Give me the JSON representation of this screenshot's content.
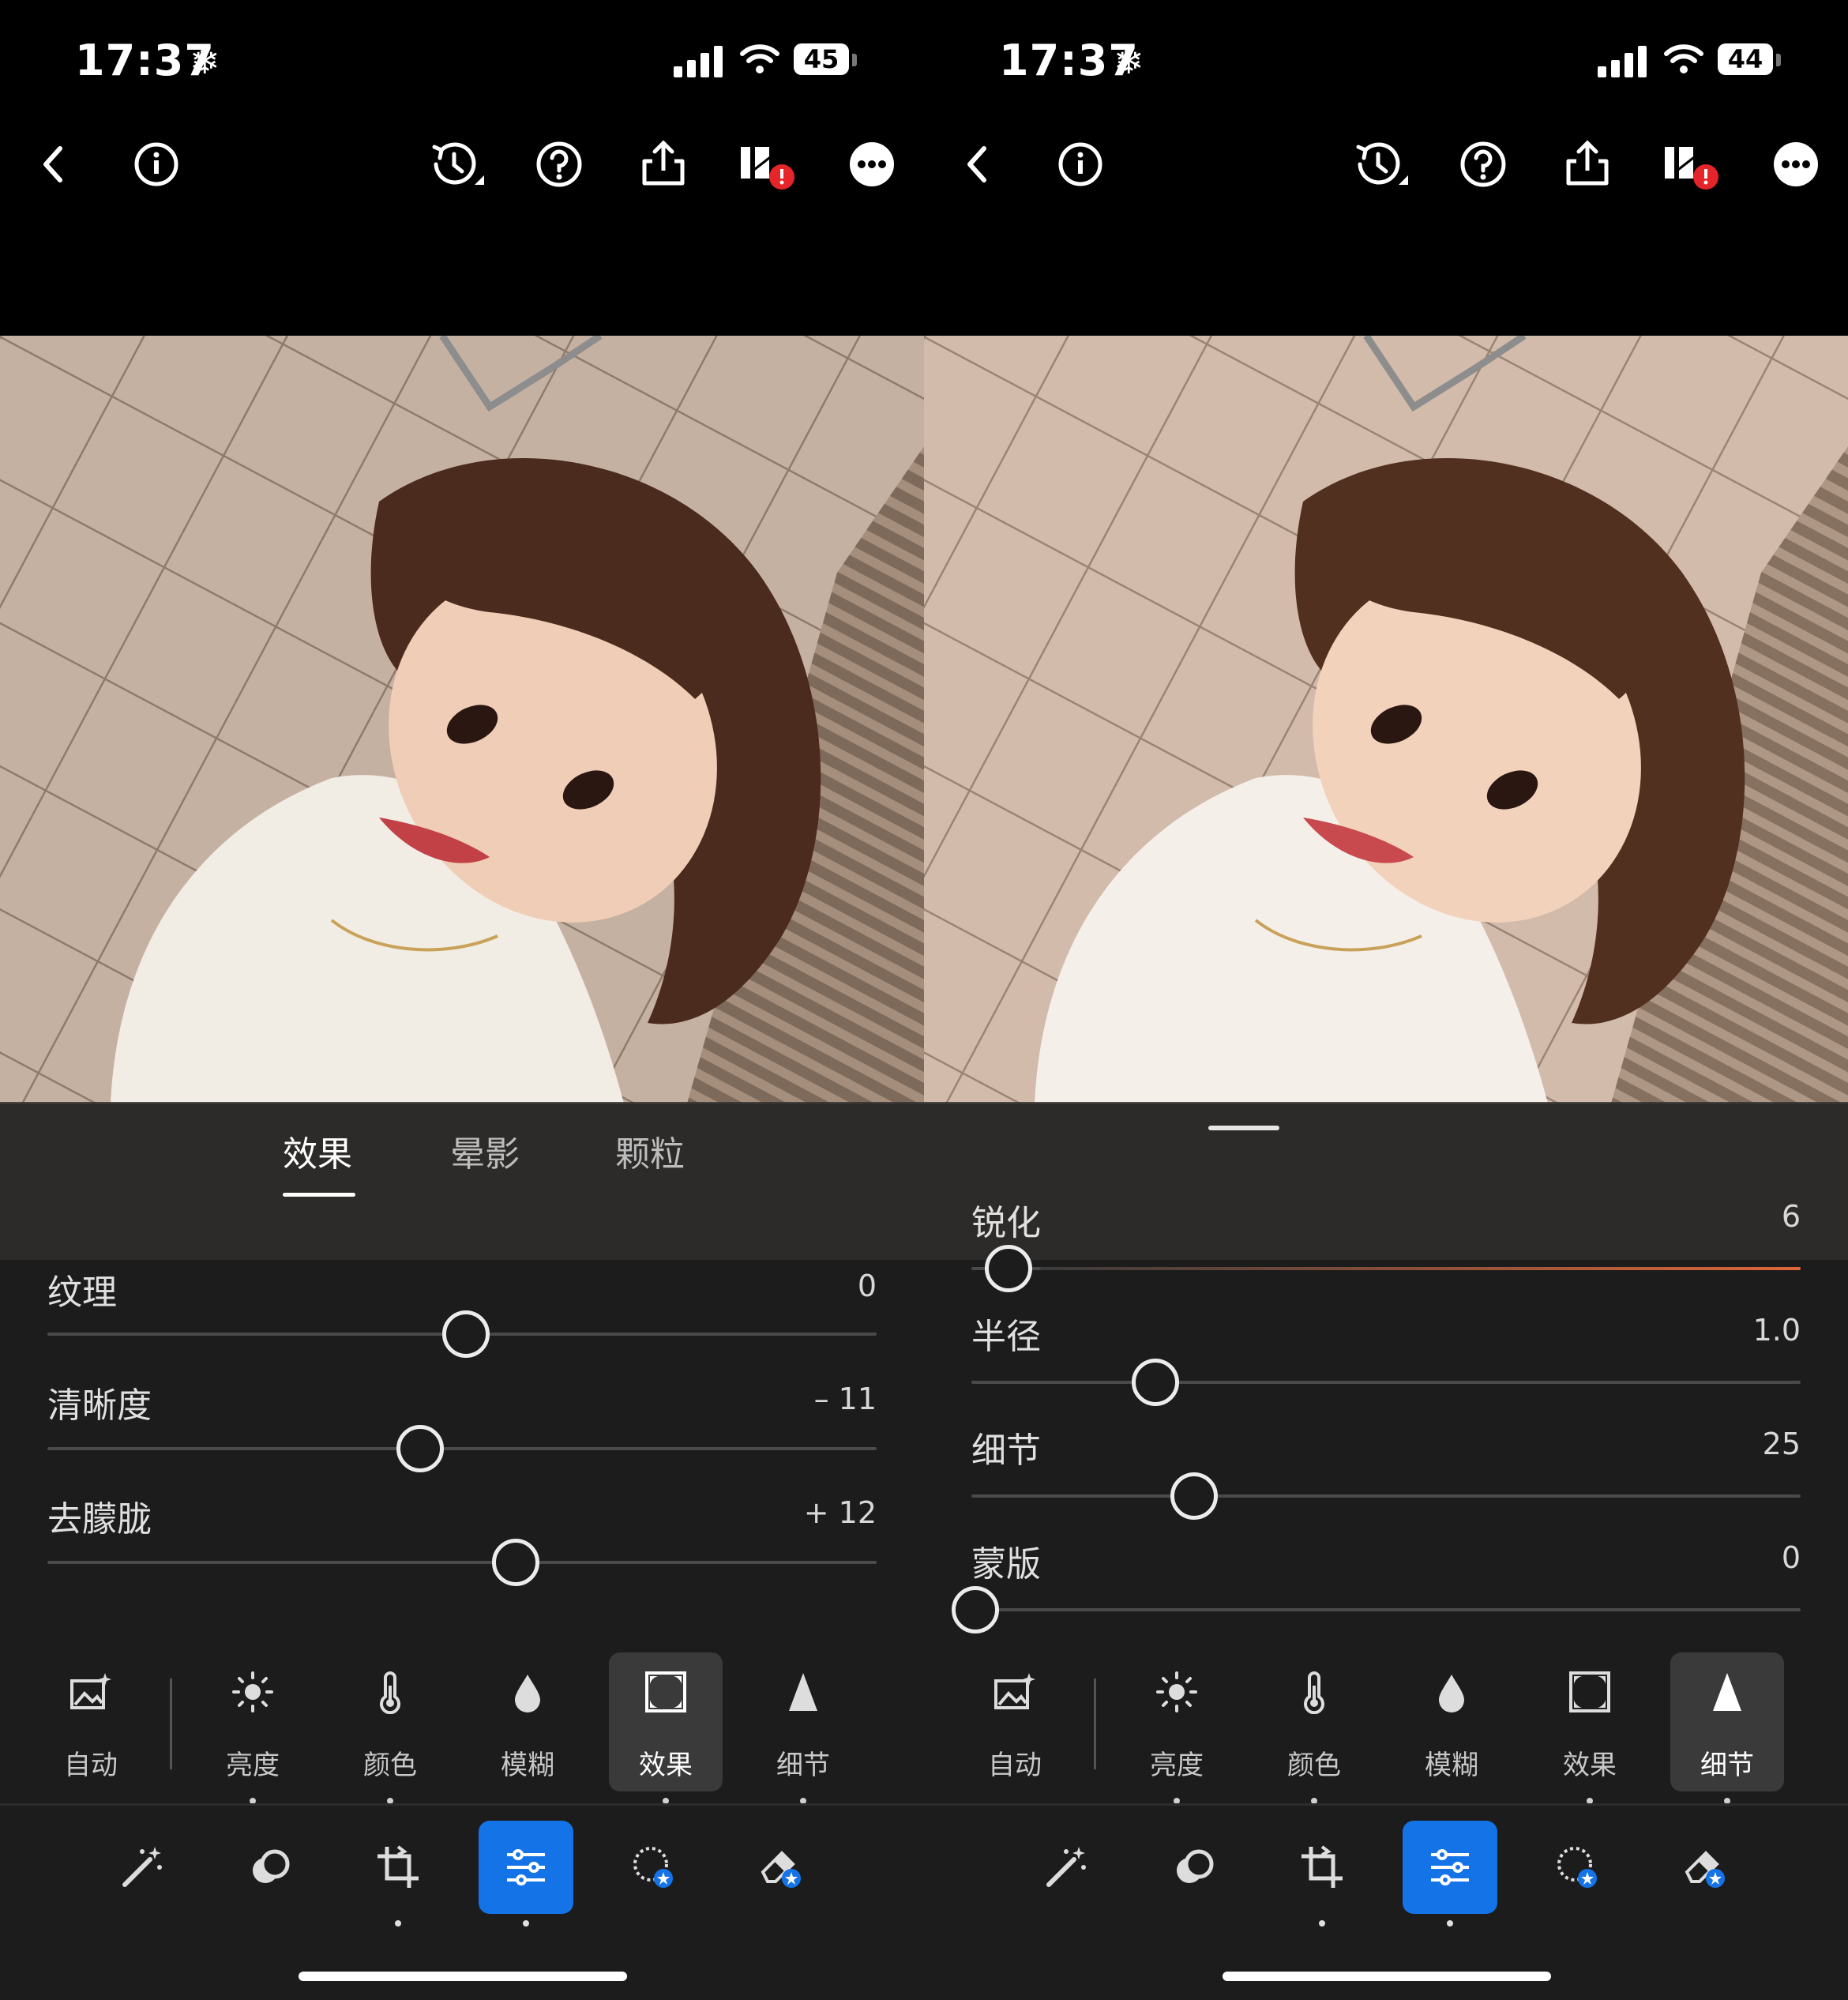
{
  "colors": {
    "accent": "#1473e6",
    "slider_fill": "#e0673a",
    "sheet_bg": "#1c1c1c"
  },
  "left": {
    "status": {
      "time": "17:37",
      "battery": "45"
    },
    "toolbar_icons": [
      "back-icon",
      "info-icon",
      "history-icon",
      "help-icon",
      "share-icon",
      "cloud-sync-error-icon",
      "more-icon"
    ],
    "subtabs": [
      "效果",
      "晕影",
      "颗粒"
    ],
    "sliders": [
      {
        "label": "纹理",
        "value": "0",
        "fraction": 0.5
      },
      {
        "label": "清晰度",
        "value": "– 11",
        "fraction": 0.445
      },
      {
        "label": "去朦胧",
        "value": "+ 12",
        "fraction": 0.56
      }
    ],
    "tools": [
      "自动",
      "亮度",
      "颜色",
      "模糊",
      "效果",
      "细节"
    ],
    "selected_tool": "效果",
    "nav_icons": [
      "edit-magic-icon",
      "presets-icon",
      "crop-icon",
      "adjust-icon",
      "masking-icon",
      "remove-icon"
    ]
  },
  "right": {
    "status": {
      "time": "17:37",
      "battery": "44"
    },
    "toolbar_icons": [
      "back-icon",
      "info-icon",
      "history-icon",
      "help-icon",
      "share-icon",
      "cloud-sync-error-icon",
      "more-icon"
    ],
    "sliders": [
      {
        "label": "锐化",
        "value": "6",
        "fraction": 0.04
      },
      {
        "label": "半径",
        "value": "1.0",
        "fraction": 0.217
      },
      {
        "label": "细节",
        "value": "25",
        "fraction": 0.264
      },
      {
        "label": "蒙版",
        "value": "0",
        "fraction": 0.0
      }
    ],
    "tools": [
      "自动",
      "亮度",
      "颜色",
      "模糊",
      "效果",
      "细节"
    ],
    "selected_tool": "细节",
    "nav_icons": [
      "edit-magic-icon",
      "presets-icon",
      "crop-icon",
      "adjust-icon",
      "masking-icon",
      "remove-icon"
    ]
  }
}
